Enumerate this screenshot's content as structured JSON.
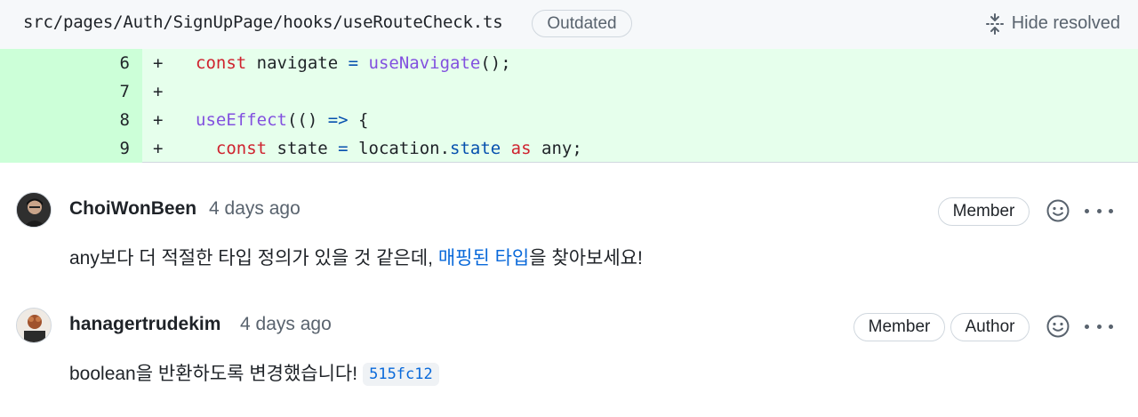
{
  "file": {
    "path": "src/pages/Auth/SignUpPage/hooks/useRouteCheck.ts",
    "status_badge": "Outdated",
    "hide_resolved_label": "Hide resolved",
    "hide_resolved_icon": "unfold-icon"
  },
  "diff": {
    "lines": [
      {
        "number": "6",
        "marker": "+"
      },
      {
        "number": "7",
        "marker": "+"
      },
      {
        "number": "8",
        "marker": "+"
      },
      {
        "number": "9",
        "marker": "+"
      }
    ],
    "tokens": {
      "l6": [
        "const",
        " navigate ",
        "=",
        " ",
        "useNavigate",
        "();"
      ],
      "l8": [
        "useEffect",
        "(() ",
        "=>",
        " {"
      ],
      "l9": [
        "  ",
        "const",
        " state ",
        "=",
        " location.",
        "state",
        " ",
        "as",
        " any;"
      ]
    }
  },
  "comments": [
    {
      "author": "ChoiWonBeen",
      "time": "4 days ago",
      "badges": [
        "Member"
      ],
      "body_before": "any보다 더 적절한 타입 정의가 있을 것 같은데, ",
      "body_link": "매핑된 타입",
      "body_after": "을 찾아보세요!"
    },
    {
      "author": "hanagertrudekim",
      "time": "4 days ago",
      "badges": [
        "Member",
        "Author"
      ],
      "body": "boolean을 반환하도록 변경했습니다!",
      "commit": "515fc12"
    }
  ],
  "colors": {
    "addition_bg": "#e6ffec",
    "addition_gutter": "#ccffd8",
    "keyword": "#cf222e",
    "function": "#8250df",
    "link": "#0969da"
  }
}
